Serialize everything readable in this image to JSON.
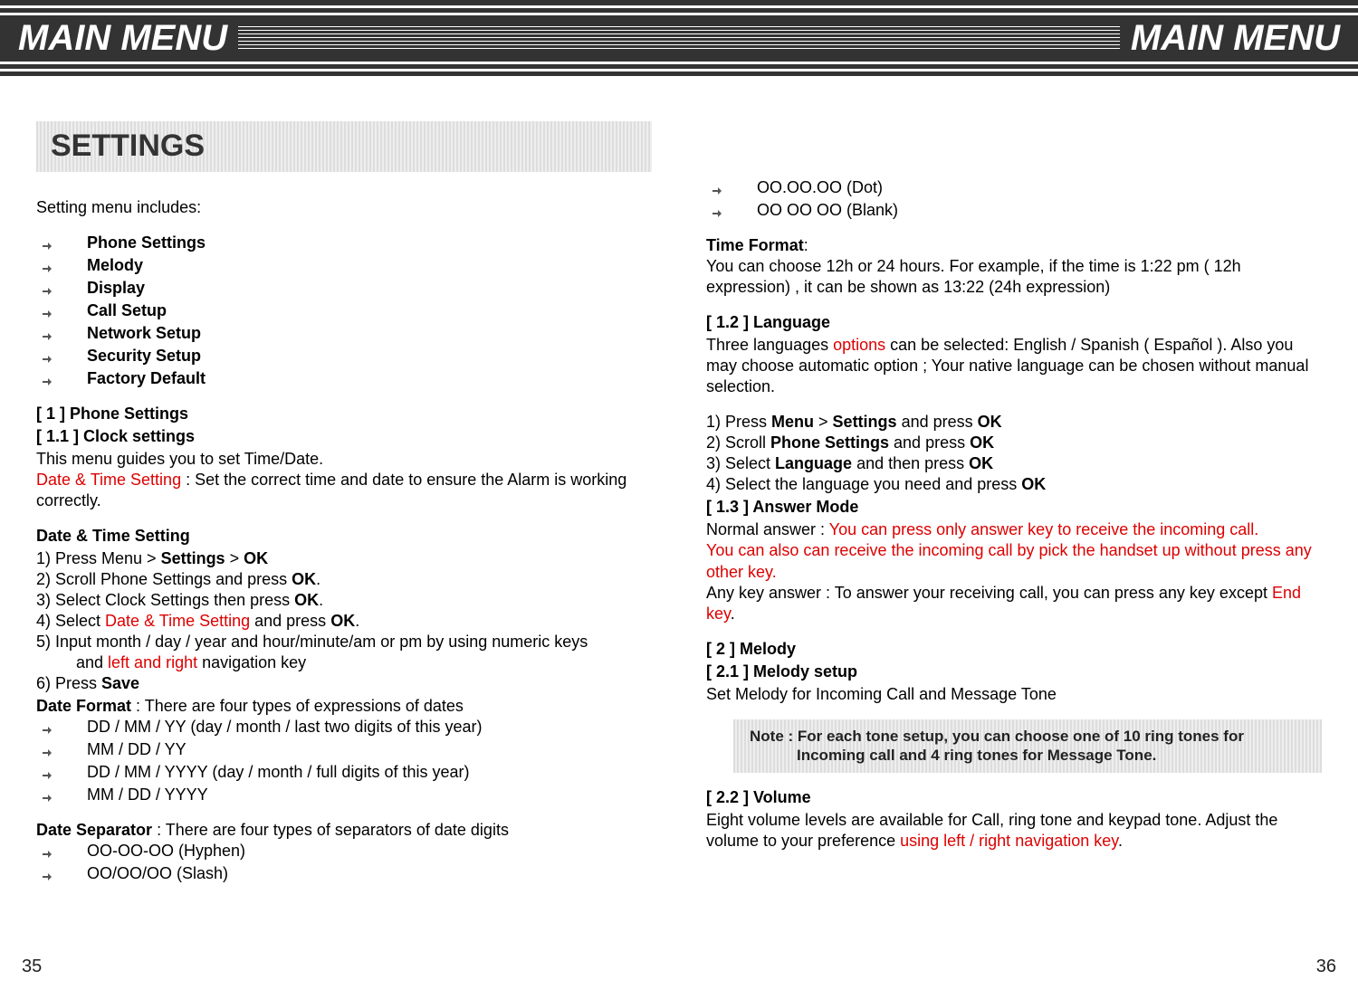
{
  "header": {
    "left": "MAIN MENU",
    "right": "MAIN MENU"
  },
  "section_title": "SETTINGS",
  "left_col": {
    "intro": "Setting menu includes:",
    "menu_items": [
      "Phone Settings",
      "Melody",
      "Display",
      "Call Setup",
      "Network Setup",
      "Security Setup",
      "Factory Default"
    ],
    "h1": "[ 1 ]  Phone Settings",
    "h11": "[ 1.1 ]  Clock settings",
    "clock_intro": "This menu guides you to set Time/Date.",
    "date_time_red": "Date & Time Setting",
    "date_time_rest": " : Set the correct time and date to ensure the Alarm is working correctly.",
    "dts_head": "Date & Time Setting",
    "steps": [
      {
        "pre": "1)  Press Menu > ",
        "b1": "Settings",
        "mid": " > ",
        "b2": "OK"
      },
      {
        "pre": "2)  Scroll Phone Settings and press ",
        "b1": "OK",
        "post": "."
      },
      {
        "pre": "3)  Select Clock Settings then press ",
        "b1": "OK",
        "post": "."
      },
      {
        "pre": "4)  Select ",
        "r1": "Date & Time Setting",
        "mid": " and press ",
        "b1": "OK",
        "post": "."
      },
      {
        "line1": "5)  Input month / day / year and hour/minute/am or pm by using numeric keys",
        "line2pre": "and ",
        "line2red": "left and right",
        "line2post": " navigation key"
      },
      {
        "pre": "6)  Press ",
        "b1": "Save"
      }
    ],
    "date_format_head": "Date Format",
    "date_format_text": " : There are four types of expressions of dates",
    "date_formats": [
      "DD / MM / YY (day / month / last two digits of this year)",
      "MM / DD / YY",
      "DD / MM / YYYY (day / month / full digits of this year)",
      "MM / DD / YYYY"
    ],
    "date_sep_head": "Date Separator",
    "date_sep_text": " : There are four types of separators of date digits",
    "separators": [
      "OO-OO-OO (Hyphen)",
      "OO/OO/OO (Slash)"
    ]
  },
  "right_col": {
    "separators_cont": [
      "OO.OO.OO (Dot)",
      "OO OO OO (Blank)"
    ],
    "time_format_head": "Time Format",
    "time_format_text": ":",
    "time_format_body": "You can choose 12h or 24 hours. For example, if the time is 1:22 pm ( 12h expression) , it can be shown as 13:22 (24h expression)",
    "h12": "[ 1.2 ]  Language",
    "lang_pre": "Three languages ",
    "lang_red": "options",
    "lang_post": " can be selected: English / Spanish ( Español ). Also you may choose automatic option ; Your native language can be chosen without manual selection.",
    "lang_steps": [
      {
        "pre": "1)  Press ",
        "b1": "Menu",
        "mid1": " > ",
        "b2": "Settings",
        "mid2": " and press ",
        "b3": "OK"
      },
      {
        "pre": "2)  Scroll ",
        "b1": "Phone Settings",
        "mid1": " and press ",
        "b2": "OK"
      },
      {
        "pre": "3)  Select ",
        "b1": "Language",
        "mid1": " and then press ",
        "b2": "OK"
      },
      {
        "pre": "4)  Select the language you need and press ",
        "b1": "OK"
      }
    ],
    "h13": "[ 1.3 ]  Answer Mode",
    "answer_normal_pre": "Normal answer : ",
    "answer_normal_red1": "You can press only answer key to receive the incoming call.",
    "answer_normal_red2": "You can also can receive the incoming call by pick the handset up without press any other key.",
    "answer_any_pre": "Any key answer : To answer your receiving call, you can press any key except ",
    "answer_any_red": "End key",
    "answer_any_post": ".",
    "h2": "[ 2 ]  Melody",
    "h21": "[ 2.1 ]  Melody setup",
    "melody_setup_text": "Set Melody for Incoming Call and Message Tone",
    "note_line1": "Note : For each tone setup, you can choose one of 10 ring tones for",
    "note_line2": "Incoming call and 4 ring tones for Message Tone.",
    "h22": "[ 2.2 ]  Volume",
    "volume_pre": "Eight volume levels are available for Call, ring tone and keypad tone. Adjust the volume to your preference ",
    "volume_red": "using left / right navigation key",
    "volume_post": "."
  },
  "page_left": "35",
  "page_right": "36"
}
